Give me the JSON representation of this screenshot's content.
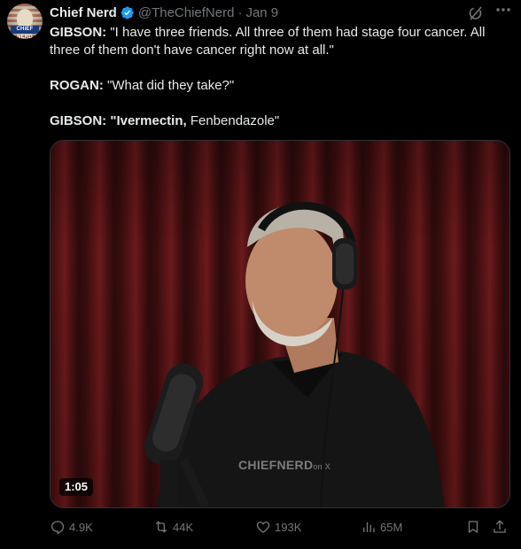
{
  "author": {
    "name": "Chief Nerd",
    "handle": "@TheChiefNerd",
    "separator": "·",
    "date": "Jan 9",
    "avatar_text": "CHIEF NERD"
  },
  "post": {
    "line1_speaker": "GIBSON:",
    "line1_text": " \"I have three friends. All three of them had stage four cancer. All three of them don't have cancer right now at all.\"",
    "line2_speaker": "ROGAN:",
    "line2_text": " \"What did they take?\"",
    "line3_speaker": "GIBSON:",
    "line3_bold_text": " \"Ivermectin,",
    "line3_text": " Fenbendazole\""
  },
  "media": {
    "duration": "1:05",
    "watermark": "CHIEFNERD",
    "watermark_suffix": "on X"
  },
  "metrics": {
    "replies": "4.9K",
    "reposts": "44K",
    "likes": "193K",
    "views": "65M"
  },
  "colors": {
    "background": "#000000",
    "text": "#e7e9ea",
    "muted": "#71767b",
    "verified": "#1d9bf0",
    "border": "#2f3336"
  },
  "icons": {
    "verified": "verified-badge-icon",
    "grok": "grok-icon",
    "more": "more-icon",
    "reply": "reply-icon",
    "repost": "repost-icon",
    "like": "like-icon",
    "views": "views-icon",
    "bookmark": "bookmark-icon",
    "share": "share-icon"
  }
}
